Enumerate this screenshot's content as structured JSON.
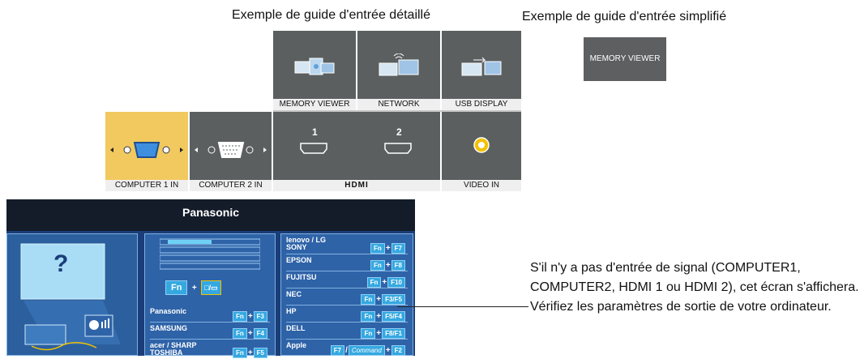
{
  "captions": {
    "detailed": "Exemple de guide d'entrée détaillé",
    "simplified": "Exemple de guide d'entrée simplifié"
  },
  "simplified_tile": {
    "label": "MEMORY VIEWER"
  },
  "top_tiles": [
    {
      "label": "MEMORY VIEWER",
      "icon": "memory-viewer-icon"
    },
    {
      "label": "NETWORK",
      "icon": "network-icon"
    },
    {
      "label": "USB DISPLAY",
      "icon": "usb-display-icon"
    }
  ],
  "bottom_tiles": [
    {
      "label": "COMPUTER 1 IN",
      "icon": "vga-connector-icon",
      "selected": true
    },
    {
      "label": "COMPUTER 2 IN",
      "icon": "vga-connector-icon",
      "selected": false
    },
    {
      "label": "HDMI",
      "numbers": [
        "1",
        "2"
      ],
      "icon": "hdmi-port-icon"
    },
    {
      "label": "VIDEO IN",
      "icon": "video-jack-icon"
    }
  ],
  "screen": {
    "brand": "Panasonic",
    "question": "?",
    "fn_combo": {
      "fn": "Fn",
      "key": "□/▭"
    },
    "middle_list": [
      {
        "brand": "Panasonic",
        "keys": [
          "Fn",
          "F3"
        ]
      },
      {
        "brand": "SAMSUNG",
        "keys": [
          "Fn",
          "F4"
        ]
      },
      {
        "brand": "acer / SHARP",
        "brand2": "TOSHIBA",
        "keys": [
          "Fn",
          "F5"
        ]
      }
    ],
    "right_list": [
      {
        "brand": "lenovo / LG",
        "brand2": "SONY",
        "keys": [
          "Fn",
          "F7"
        ]
      },
      {
        "brand": "EPSON",
        "keys": [
          "Fn",
          "F8"
        ]
      },
      {
        "brand": "FUJITSU",
        "keys": [
          "Fn",
          "F10"
        ]
      },
      {
        "brand": "NEC",
        "keys": [
          "Fn",
          "F3/F5"
        ]
      },
      {
        "brand": "HP",
        "keys": [
          "Fn",
          "F5/F4"
        ]
      },
      {
        "brand": "DELL",
        "keys": [
          "Fn",
          "F8/F1"
        ]
      },
      {
        "brand": "Apple",
        "keys": [
          "F7",
          "Command",
          "F2"
        ]
      }
    ]
  },
  "note": "S'il n'y a pas d'entrée de signal (COMPUTER1, COMPUTER2, HDMI 1 ou HDMI 2), cet écran s'affichera. Vérifiez les paramètres de sortie de votre ordinateur.",
  "colors": {
    "selected": "#f2c95e",
    "tile": "#5b5f60",
    "screen_bg": "#1a3e79",
    "key": "#35a8e0"
  }
}
